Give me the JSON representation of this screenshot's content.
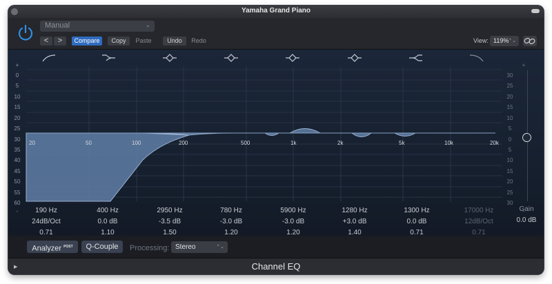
{
  "window": {
    "title": "Yamaha Grand Piano"
  },
  "header": {
    "preset": "Manual",
    "prev_symbol": "<",
    "next_symbol": ">",
    "buttons": {
      "compare": "Compare",
      "copy": "Copy",
      "paste": "Paste",
      "undo": "Undo",
      "redo": "Redo"
    },
    "view_label": "View:",
    "view_value": "119%"
  },
  "eq": {
    "db_scale_left": [
      "+",
      "0",
      "5",
      "10",
      "15",
      "20",
      "25",
      "30",
      "35",
      "40",
      "45",
      "50",
      "55",
      "60",
      "-"
    ],
    "db_scale_right": [
      "+",
      "30",
      "25",
      "20",
      "15",
      "10",
      "5",
      "0",
      "5",
      "10",
      "15",
      "20",
      "25",
      "30",
      "-"
    ],
    "freq_labels": [
      "20",
      "50",
      "100",
      "200",
      "500",
      "1k",
      "2k",
      "5k",
      "10k",
      "20k"
    ],
    "band_icons": [
      "low-cut-icon",
      "low-shelf-icon",
      "bell-icon",
      "bell-icon",
      "bell-icon",
      "bell-icon",
      "high-shelf-icon",
      "high-cut-icon"
    ]
  },
  "bands": [
    {
      "freq": "190 Hz",
      "gain": "24dB/Oct",
      "q": "0.71",
      "enabled": true
    },
    {
      "freq": "400 Hz",
      "gain": "0.0 dB",
      "q": "1.10",
      "enabled": true
    },
    {
      "freq": "2950 Hz",
      "gain": "-3.5 dB",
      "q": "1.50",
      "enabled": true
    },
    {
      "freq": "780 Hz",
      "gain": "-3.0 dB",
      "q": "1.20",
      "enabled": true
    },
    {
      "freq": "5900 Hz",
      "gain": "-3.0 dB",
      "q": "1.20",
      "enabled": true
    },
    {
      "freq": "1280 Hz",
      "gain": "+3.0 dB",
      "q": "1.40",
      "enabled": true
    },
    {
      "freq": "1300 Hz",
      "gain": "0.0 dB",
      "q": "0.71",
      "enabled": true
    },
    {
      "freq": "17000 Hz",
      "gain": "12dB/Oct",
      "q": "0.71",
      "enabled": false
    }
  ],
  "gain": {
    "label": "Gain",
    "value": "0.0 dB"
  },
  "footer": {
    "analyzer_label": "Analyzer",
    "analyzer_badge": "POST",
    "qcouple_label": "Q-Couple",
    "processing_label": "Processing:",
    "processing_value": "Stereo"
  },
  "plugin_name": "Channel EQ",
  "colors": {
    "accent": "#2f6cc0",
    "curve_fill": "#5f7ea6",
    "background": "#16202f"
  }
}
